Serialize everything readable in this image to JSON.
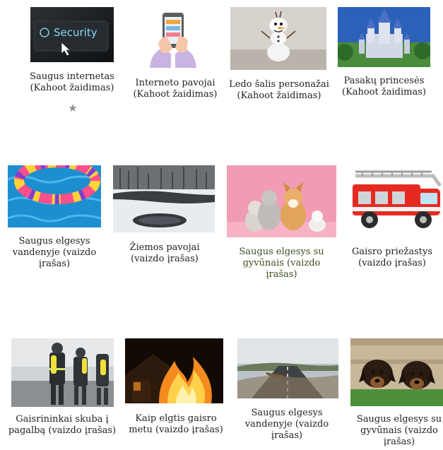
{
  "items": [
    {
      "title": "Saugus internetas (Kahoot žaidimas)",
      "image": "security-keyboard",
      "starred": true
    },
    {
      "title": "Interneto pavojai (Kahoot žaidimas)",
      "image": "hands-phone"
    },
    {
      "title": "Ledo šalis personažai (Kahoot žaidimas)",
      "image": "olaf-toy"
    },
    {
      "title": "Pasakų princesės (Kahoot žaidimas)",
      "image": "disney-castle"
    },
    {
      "title": "Saugus elgesys vandenyje (vaizdo įrašas)",
      "image": "pool-ring"
    },
    {
      "title": "Žiemos pavojai (vaizdo įrašas)",
      "image": "frozen-pond"
    },
    {
      "title": "Saugus elgesys su gyvūnais (vaizdo įrašas)",
      "image": "dogs-pink"
    },
    {
      "title": "Gaisro priežastys (vaizdo įrašas)",
      "image": "fire-truck"
    },
    {
      "title": "Gaisrininkai skuba į pagalbą (vaizdo įrašas)",
      "image": "firefighters"
    },
    {
      "title": "Kaip elgtis gaisro metu (vaizdo įrašas)",
      "image": "house-fire"
    },
    {
      "title": "Saugus elgesys vandenyje (vaizdo įrašas)",
      "image": "flooded-road"
    },
    {
      "title": "Saugus elgesys su gyvūnais (vaizdo įrašas)",
      "image": "puppies-fence"
    }
  ],
  "colors": {
    "caption": "#222222",
    "star": "#8d8d8d"
  }
}
